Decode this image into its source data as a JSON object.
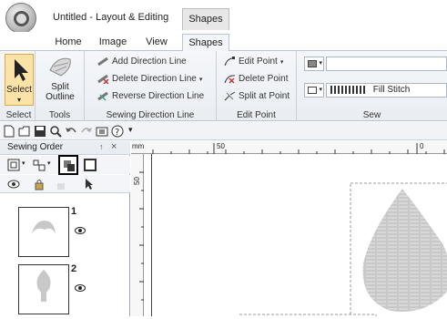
{
  "window": {
    "title": "Untitled - Layout & Editing",
    "context_tab": "Shapes"
  },
  "tabs": [
    {
      "label": "Home"
    },
    {
      "label": "Image"
    },
    {
      "label": "View"
    },
    {
      "label": "Shapes"
    }
  ],
  "ribbon": {
    "select": {
      "button_label": "Select",
      "group_label": "Select"
    },
    "tools": {
      "button_label_1": "Split",
      "button_label_2": "Outline",
      "group_label": "Tools"
    },
    "sewing_direction": {
      "add": "Add Direction Line",
      "delete": "Delete Direction Line",
      "reverse": "Reverse Direction Line",
      "group_label": "Sewing Direction Line"
    },
    "edit_point": {
      "edit": "Edit Point",
      "delete": "Delete Point",
      "split": "Split at Point",
      "group_label": "Edit Point"
    },
    "sew": {
      "fill_stitch": "Fill Stitch",
      "group_label": "Sew"
    }
  },
  "panel": {
    "title": "Sewing Order",
    "pin": "↑",
    "close": "×",
    "items": [
      {
        "number": "1"
      },
      {
        "number": "2"
      }
    ]
  },
  "rulers": {
    "unit": "mm",
    "top_labels": [
      "50",
      "0"
    ],
    "left_label": "50"
  },
  "colors": {
    "accent": "#b7c5d8",
    "stitch_gray": "#c8c8c8"
  }
}
